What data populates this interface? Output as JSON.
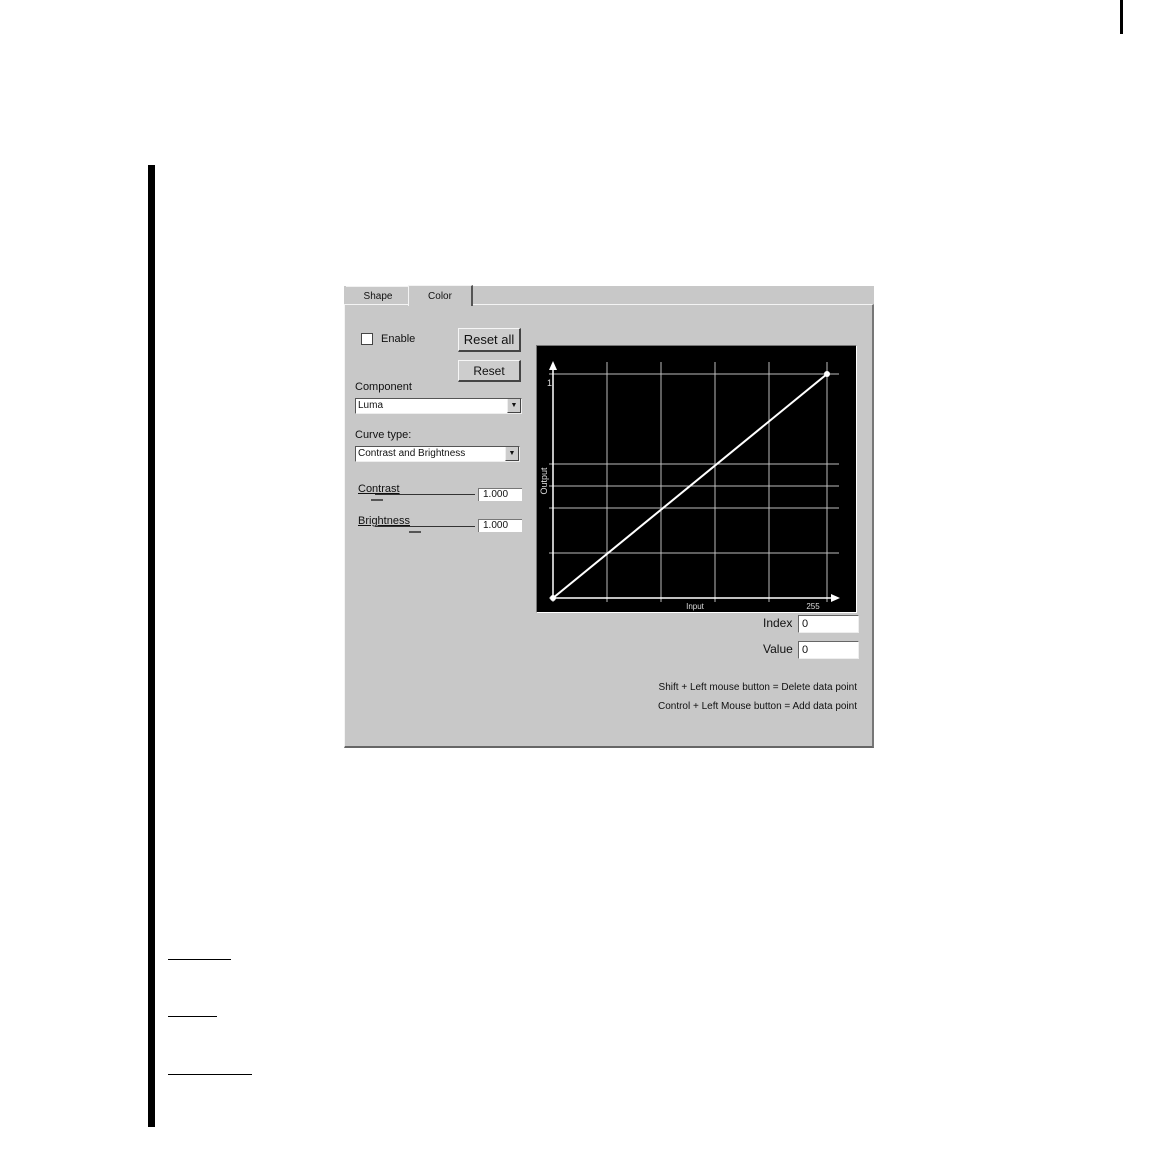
{
  "tabs": [
    {
      "label": "Shape"
    },
    {
      "label": "Color"
    }
  ],
  "enable": {
    "label": "Enable",
    "checked": false
  },
  "buttons": {
    "reset_all": "Reset all",
    "reset": "Reset"
  },
  "component": {
    "label": "Component",
    "value": "Luma"
  },
  "curve_type": {
    "label": "Curve type:",
    "value": "Contrast and Brightness"
  },
  "contrast": {
    "label": "Contrast",
    "value": "1.000"
  },
  "brightness": {
    "label": "Brightness",
    "value": "1.000"
  },
  "graph": {
    "x_label": "Input",
    "y_label": "Output",
    "x_max_label": "255",
    "y_max_label": "1",
    "points": [
      [
        0,
        0
      ],
      [
        1,
        1
      ]
    ],
    "colors": {
      "background": "#000000",
      "grid": "#bdbdbd",
      "curve": "#ffffff"
    }
  },
  "index": {
    "label": "Index",
    "value": "0"
  },
  "value": {
    "label": "Value",
    "value": "0"
  },
  "hints": [
    "Shift + Left mouse button = Delete data point",
    "Control + Left Mouse button = Add data point"
  ]
}
